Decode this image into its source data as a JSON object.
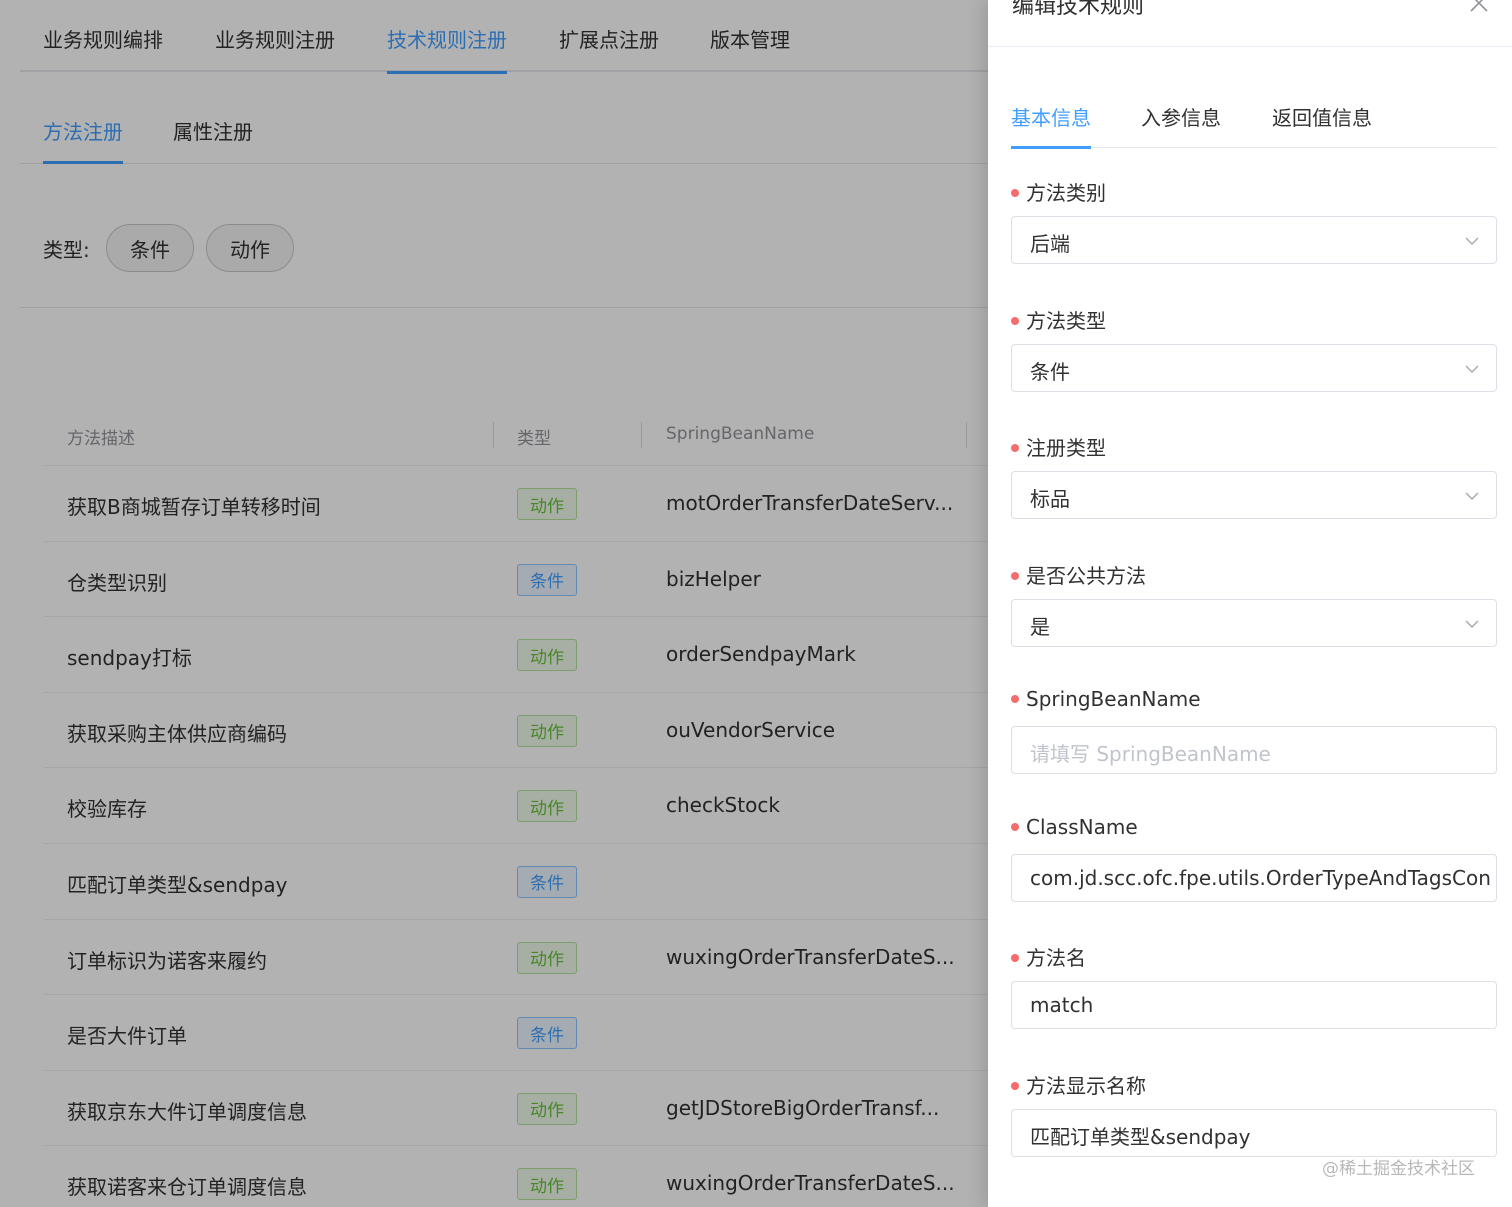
{
  "main_tabs": [
    "业务规则编排",
    "业务规则注册",
    "技术规则注册",
    "扩展点注册",
    "版本管理"
  ],
  "main_active": "技术规则注册",
  "sub_tabs": [
    "方法注册",
    "属性注册"
  ],
  "filter": {
    "label": "类型:",
    "options": [
      "条件",
      "动作"
    ]
  },
  "table": {
    "headers": [
      "方法描述",
      "类型",
      "SpringBeanName"
    ],
    "rows": [
      {
        "desc": "获取B商城暂存订单转移时间",
        "type": "动作",
        "kind": "action",
        "bean": "motOrderTransferDateServ..."
      },
      {
        "desc": "仓类型识别",
        "type": "条件",
        "kind": "cond",
        "bean": "bizHelper"
      },
      {
        "desc": "sendpay打标",
        "type": "动作",
        "kind": "action",
        "bean": "orderSendpayMark"
      },
      {
        "desc": "获取采购主体供应商编码",
        "type": "动作",
        "kind": "action",
        "bean": "ouVendorService"
      },
      {
        "desc": "校验库存",
        "type": "动作",
        "kind": "action",
        "bean": "checkStock"
      },
      {
        "desc": "匹配订单类型&sendpay",
        "type": "条件",
        "kind": "cond",
        "bean": ""
      },
      {
        "desc": "订单标识为诺客来履约",
        "type": "动作",
        "kind": "action",
        "bean": "wuxingOrderTransferDateS..."
      },
      {
        "desc": "是否大件订单",
        "type": "条件",
        "kind": "cond",
        "bean": ""
      },
      {
        "desc": "获取京东大件订单调度信息",
        "type": "动作",
        "kind": "action",
        "bean": "getJDStoreBigOrderTransf..."
      },
      {
        "desc": "获取诺客来仓订单调度信息",
        "type": "动作",
        "kind": "action",
        "bean": "wuxingOrderTransferDateS..."
      }
    ]
  },
  "drawer": {
    "title": "编辑技术规则",
    "tabs": [
      "基本信息",
      "入参信息",
      "返回值信息"
    ],
    "fields": {
      "method_category": {
        "label": "方法类别",
        "value": "后端"
      },
      "method_type": {
        "label": "方法类型",
        "value": "条件"
      },
      "register_type": {
        "label": "注册类型",
        "value": "标品"
      },
      "is_public": {
        "label": "是否公共方法",
        "value": "是"
      },
      "spring_bean": {
        "label": "SpringBeanName",
        "placeholder": "请填写 SpringBeanName",
        "value": ""
      },
      "class_name": {
        "label": "ClassName",
        "value": "com.jd.scc.ofc.fpe.utils.OrderTypeAndTagsCon"
      },
      "method_name": {
        "label": "方法名",
        "value": "match"
      },
      "display_name": {
        "label": "方法显示名称",
        "value": "匹配订单类型&sendpay"
      }
    }
  },
  "watermark": "@稀土掘金技术社区",
  "colors": {
    "accent": "#409eff",
    "required": "#f56c6c",
    "tag_action": "#67c23a",
    "tag_condition": "#409eff"
  },
  "icons": [
    "close-icon",
    "chevron-down-icon"
  ]
}
